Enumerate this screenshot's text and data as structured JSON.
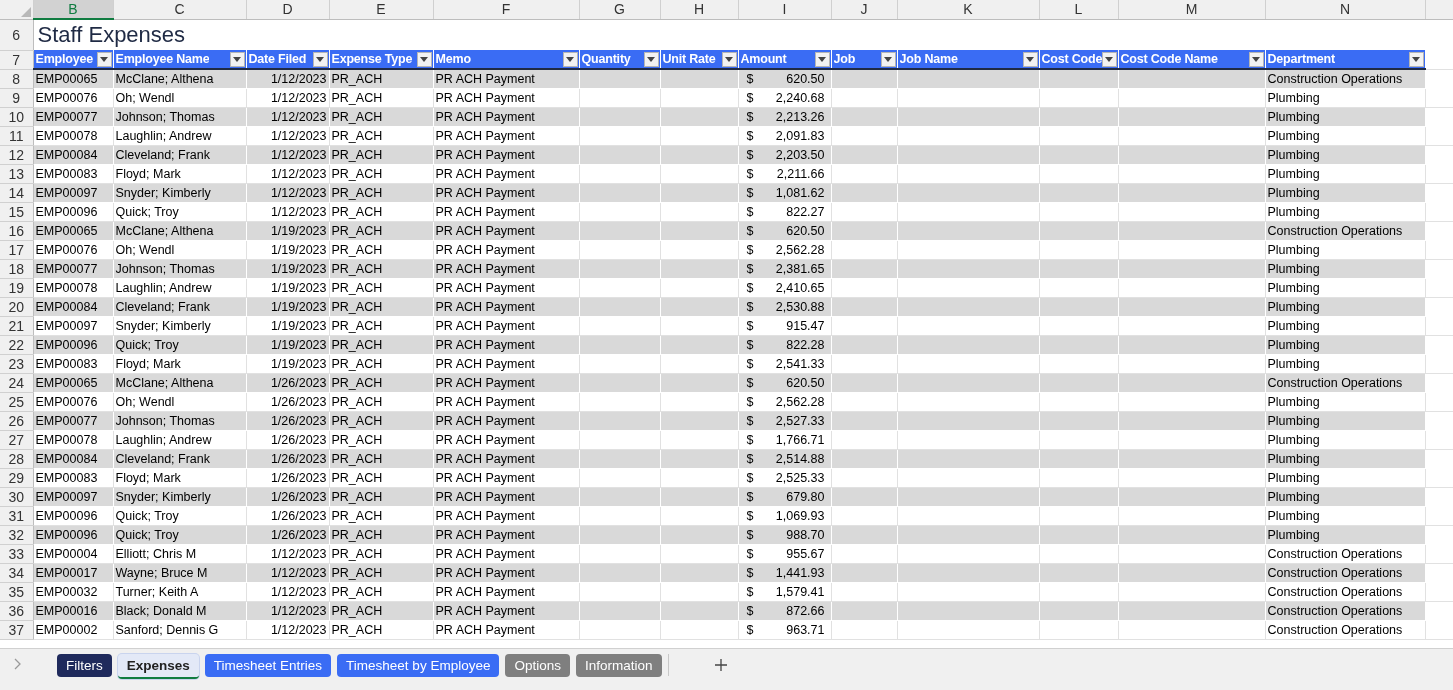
{
  "column_letters": [
    {
      "label": "B",
      "selected": true
    },
    {
      "label": "C",
      "selected": false
    },
    {
      "label": "D",
      "selected": false
    },
    {
      "label": "E",
      "selected": false
    },
    {
      "label": "F",
      "selected": false
    },
    {
      "label": "G",
      "selected": false
    },
    {
      "label": "H",
      "selected": false
    },
    {
      "label": "I",
      "selected": false
    },
    {
      "label": "J",
      "selected": false
    },
    {
      "label": "K",
      "selected": false
    },
    {
      "label": "L",
      "selected": false
    },
    {
      "label": "M",
      "selected": false
    },
    {
      "label": "N",
      "selected": false
    }
  ],
  "title": {
    "row": "6",
    "text": "Staff Expenses"
  },
  "header_row": "7",
  "columns": [
    "Employee",
    "Employee Name",
    "Date Filed",
    "Expense Type",
    "Memo",
    "Quantity",
    "Unit Rate",
    "Amount",
    "Job",
    "Job Name",
    "Cost Code",
    "Cost Code Name",
    "Department"
  ],
  "rows": [
    {
      "row": "8",
      "employee": "EMP00065",
      "name": "McClane; Althena",
      "date": "1/12/2023",
      "type": "PR_ACH",
      "memo": "PR ACH Payment",
      "currency": "$",
      "amount": "620.50",
      "department": "Construction Operations"
    },
    {
      "row": "9",
      "employee": "EMP00076",
      "name": "Oh; Wendl",
      "date": "1/12/2023",
      "type": "PR_ACH",
      "memo": "PR ACH Payment",
      "currency": "$",
      "amount": "2,240.68",
      "department": "Plumbing"
    },
    {
      "row": "10",
      "employee": "EMP00077",
      "name": "Johnson; Thomas",
      "date": "1/12/2023",
      "type": "PR_ACH",
      "memo": "PR ACH Payment",
      "currency": "$",
      "amount": "2,213.26",
      "department": "Plumbing"
    },
    {
      "row": "11",
      "employee": "EMP00078",
      "name": "Laughlin; Andrew",
      "date": "1/12/2023",
      "type": "PR_ACH",
      "memo": "PR ACH Payment",
      "currency": "$",
      "amount": "2,091.83",
      "department": "Plumbing"
    },
    {
      "row": "12",
      "employee": "EMP00084",
      "name": "Cleveland; Frank",
      "date": "1/12/2023",
      "type": "PR_ACH",
      "memo": "PR ACH Payment",
      "currency": "$",
      "amount": "2,203.50",
      "department": "Plumbing"
    },
    {
      "row": "13",
      "employee": "EMP00083",
      "name": "Floyd; Mark",
      "date": "1/12/2023",
      "type": "PR_ACH",
      "memo": "PR ACH Payment",
      "currency": "$",
      "amount": "2,211.66",
      "department": "Plumbing"
    },
    {
      "row": "14",
      "employee": "EMP00097",
      "name": "Snyder; Kimberly",
      "date": "1/12/2023",
      "type": "PR_ACH",
      "memo": "PR ACH Payment",
      "currency": "$",
      "amount": "1,081.62",
      "department": "Plumbing"
    },
    {
      "row": "15",
      "employee": "EMP00096",
      "name": "Quick; Troy",
      "date": "1/12/2023",
      "type": "PR_ACH",
      "memo": "PR ACH Payment",
      "currency": "$",
      "amount": "822.27",
      "department": "Plumbing"
    },
    {
      "row": "16",
      "employee": "EMP00065",
      "name": "McClane; Althena",
      "date": "1/19/2023",
      "type": "PR_ACH",
      "memo": "PR ACH Payment",
      "currency": "$",
      "amount": "620.50",
      "department": "Construction Operations"
    },
    {
      "row": "17",
      "employee": "EMP00076",
      "name": "Oh; Wendl",
      "date": "1/19/2023",
      "type": "PR_ACH",
      "memo": "PR ACH Payment",
      "currency": "$",
      "amount": "2,562.28",
      "department": "Plumbing"
    },
    {
      "row": "18",
      "employee": "EMP00077",
      "name": "Johnson; Thomas",
      "date": "1/19/2023",
      "type": "PR_ACH",
      "memo": "PR ACH Payment",
      "currency": "$",
      "amount": "2,381.65",
      "department": "Plumbing"
    },
    {
      "row": "19",
      "employee": "EMP00078",
      "name": "Laughlin; Andrew",
      "date": "1/19/2023",
      "type": "PR_ACH",
      "memo": "PR ACH Payment",
      "currency": "$",
      "amount": "2,410.65",
      "department": "Plumbing"
    },
    {
      "row": "20",
      "employee": "EMP00084",
      "name": "Cleveland; Frank",
      "date": "1/19/2023",
      "type": "PR_ACH",
      "memo": "PR ACH Payment",
      "currency": "$",
      "amount": "2,530.88",
      "department": "Plumbing"
    },
    {
      "row": "21",
      "employee": "EMP00097",
      "name": "Snyder; Kimberly",
      "date": "1/19/2023",
      "type": "PR_ACH",
      "memo": "PR ACH Payment",
      "currency": "$",
      "amount": "915.47",
      "department": "Plumbing"
    },
    {
      "row": "22",
      "employee": "EMP00096",
      "name": "Quick; Troy",
      "date": "1/19/2023",
      "type": "PR_ACH",
      "memo": "PR ACH Payment",
      "currency": "$",
      "amount": "822.28",
      "department": "Plumbing"
    },
    {
      "row": "23",
      "employee": "EMP00083",
      "name": "Floyd; Mark",
      "date": "1/19/2023",
      "type": "PR_ACH",
      "memo": "PR ACH Payment",
      "currency": "$",
      "amount": "2,541.33",
      "department": "Plumbing"
    },
    {
      "row": "24",
      "employee": "EMP00065",
      "name": "McClane; Althena",
      "date": "1/26/2023",
      "type": "PR_ACH",
      "memo": "PR ACH Payment",
      "currency": "$",
      "amount": "620.50",
      "department": "Construction Operations"
    },
    {
      "row": "25",
      "employee": "EMP00076",
      "name": "Oh; Wendl",
      "date": "1/26/2023",
      "type": "PR_ACH",
      "memo": "PR ACH Payment",
      "currency": "$",
      "amount": "2,562.28",
      "department": "Plumbing"
    },
    {
      "row": "26",
      "employee": "EMP00077",
      "name": "Johnson; Thomas",
      "date": "1/26/2023",
      "type": "PR_ACH",
      "memo": "PR ACH Payment",
      "currency": "$",
      "amount": "2,527.33",
      "department": "Plumbing"
    },
    {
      "row": "27",
      "employee": "EMP00078",
      "name": "Laughlin; Andrew",
      "date": "1/26/2023",
      "type": "PR_ACH",
      "memo": "PR ACH Payment",
      "currency": "$",
      "amount": "1,766.71",
      "department": "Plumbing"
    },
    {
      "row": "28",
      "employee": "EMP00084",
      "name": "Cleveland; Frank",
      "date": "1/26/2023",
      "type": "PR_ACH",
      "memo": "PR ACH Payment",
      "currency": "$",
      "amount": "2,514.88",
      "department": "Plumbing"
    },
    {
      "row": "29",
      "employee": "EMP00083",
      "name": "Floyd; Mark",
      "date": "1/26/2023",
      "type": "PR_ACH",
      "memo": "PR ACH Payment",
      "currency": "$",
      "amount": "2,525.33",
      "department": "Plumbing"
    },
    {
      "row": "30",
      "employee": "EMP00097",
      "name": "Snyder; Kimberly",
      "date": "1/26/2023",
      "type": "PR_ACH",
      "memo": "PR ACH Payment",
      "currency": "$",
      "amount": "679.80",
      "department": "Plumbing"
    },
    {
      "row": "31",
      "employee": "EMP00096",
      "name": "Quick; Troy",
      "date": "1/26/2023",
      "type": "PR_ACH",
      "memo": "PR ACH Payment",
      "currency": "$",
      "amount": "1,069.93",
      "department": "Plumbing"
    },
    {
      "row": "32",
      "employee": "EMP00096",
      "name": "Quick; Troy",
      "date": "1/26/2023",
      "type": "PR_ACH",
      "memo": "PR ACH Payment",
      "currency": "$",
      "amount": "988.70",
      "department": "Plumbing"
    },
    {
      "row": "33",
      "employee": "EMP00004",
      "name": "Elliott; Chris M",
      "date": "1/12/2023",
      "type": "PR_ACH",
      "memo": "PR ACH Payment",
      "currency": "$",
      "amount": "955.67",
      "department": "Construction Operations"
    },
    {
      "row": "34",
      "employee": "EMP00017",
      "name": "Wayne; Bruce M",
      "date": "1/12/2023",
      "type": "PR_ACH",
      "memo": "PR ACH Payment",
      "currency": "$",
      "amount": "1,441.93",
      "department": "Construction Operations"
    },
    {
      "row": "35",
      "employee": "EMP00032",
      "name": "Turner; Keith A",
      "date": "1/12/2023",
      "type": "PR_ACH",
      "memo": "PR ACH Payment",
      "currency": "$",
      "amount": "1,579.41",
      "department": "Construction Operations"
    },
    {
      "row": "36",
      "employee": "EMP00016",
      "name": "Black; Donald M",
      "date": "1/12/2023",
      "type": "PR_ACH",
      "memo": "PR ACH Payment",
      "currency": "$",
      "amount": "872.66",
      "department": "Construction Operations"
    },
    {
      "row": "37",
      "employee": "EMP00002",
      "name": "Sanford; Dennis G",
      "date": "1/12/2023",
      "type": "PR_ACH",
      "memo": "PR ACH Payment",
      "currency": "$",
      "amount": "963.71",
      "department": "Construction Operations"
    }
  ],
  "sheet_tabs": [
    {
      "label": "Filters",
      "selected": false,
      "color": "#1f2a5c"
    },
    {
      "label": "Expenses",
      "selected": true,
      "color": "#e3e9f7"
    },
    {
      "label": "Timesheet Entries",
      "selected": false,
      "color": "#3a6cf4"
    },
    {
      "label": "Timesheet by Employee",
      "selected": false,
      "color": "#3a6cf4"
    },
    {
      "label": "Options",
      "selected": false,
      "color": "#7f7f7f"
    },
    {
      "label": "Information",
      "selected": false,
      "color": "#7f7f7f"
    }
  ]
}
